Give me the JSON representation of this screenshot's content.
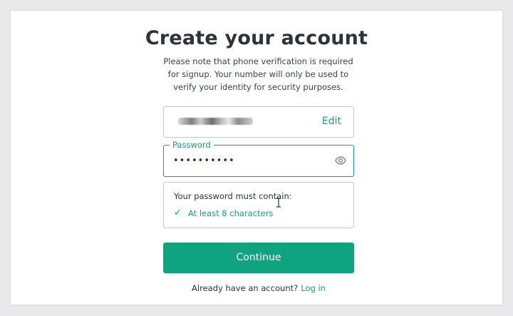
{
  "page": {
    "title": "Create your account",
    "subtitle": "Please note that phone verification is required for signup. Your number will only be used to verify your identity for security purposes."
  },
  "email": {
    "edit_label": "Edit"
  },
  "password": {
    "label": "Password",
    "value": "••••••••••"
  },
  "requirements": {
    "heading": "Your password must contain:",
    "items": [
      {
        "check": "✓",
        "label": "At least 8 characters",
        "met": true
      }
    ]
  },
  "actions": {
    "continue_label": "Continue"
  },
  "footer": {
    "prompt": "Already have an account?",
    "login_label": "Log in"
  },
  "colors": {
    "accent": "#10a37f",
    "border": "#c2c8d0",
    "text": "#2d333a"
  },
  "icons": {
    "password_visibility": "eye-icon",
    "requirement_met": "check-icon",
    "pointer": "text-cursor-icon"
  }
}
